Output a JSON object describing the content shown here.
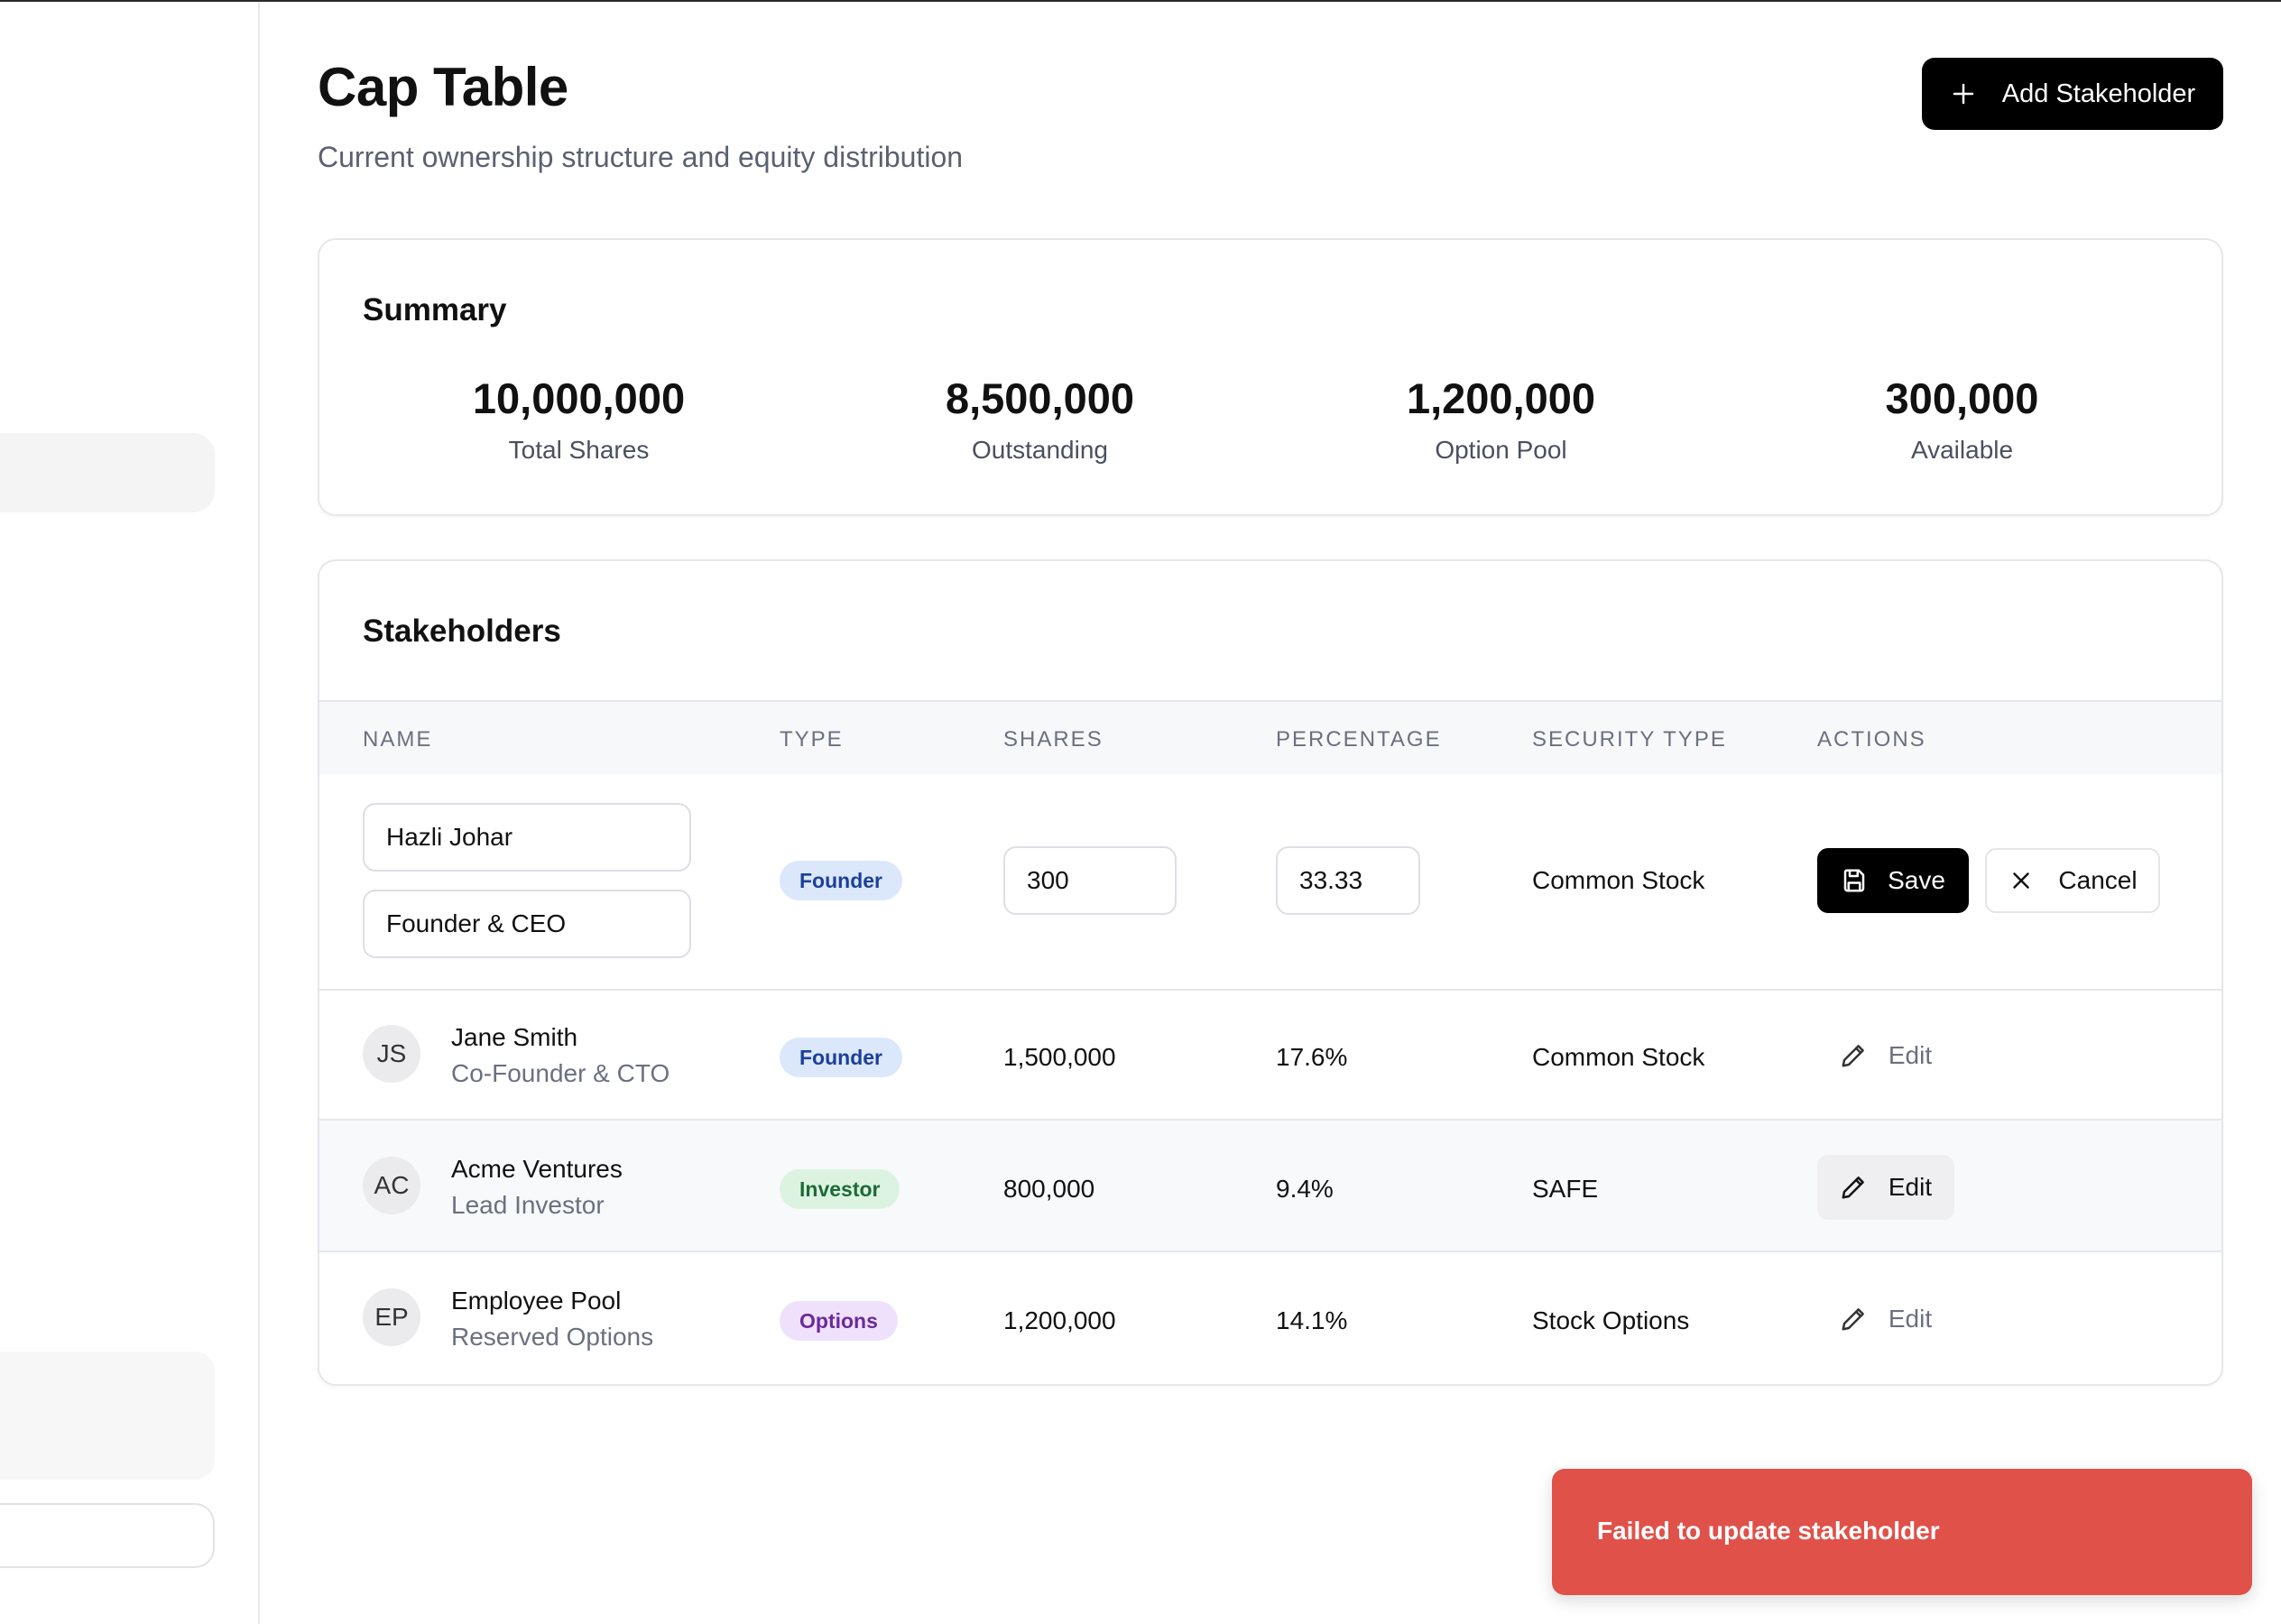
{
  "page": {
    "title": "Cap Table",
    "subtitle": "Current ownership structure and equity distribution",
    "add_button_label": "Add Stakeholder"
  },
  "summary": {
    "title": "Summary",
    "stats": [
      {
        "value": "10,000,000",
        "label": "Total Shares"
      },
      {
        "value": "8,500,000",
        "label": "Outstanding"
      },
      {
        "value": "1,200,000",
        "label": "Option Pool"
      },
      {
        "value": "300,000",
        "label": "Available"
      }
    ]
  },
  "stakeholders": {
    "title": "Stakeholders",
    "columns": [
      "Name",
      "Type",
      "Shares",
      "Percentage",
      "Security Type",
      "Actions"
    ],
    "editing_row": {
      "name_value": "Hazli Johar",
      "role_value": "Founder & CEO",
      "type": "Founder",
      "shares_value": "300",
      "percentage_value": "33.33",
      "security_type": "Common Stock",
      "save_label": "Save",
      "cancel_label": "Cancel"
    },
    "rows": [
      {
        "initials": "JS",
        "name": "Jane Smith",
        "role": "Co-Founder & CTO",
        "type": "Founder",
        "shares": "1,500,000",
        "percentage": "17.6%",
        "security_type": "Common Stock",
        "action_label": "Edit"
      },
      {
        "initials": "AC",
        "name": "Acme Ventures",
        "role": "Lead Investor",
        "type": "Investor",
        "shares": "800,000",
        "percentage": "9.4%",
        "security_type": "SAFE",
        "action_label": "Edit"
      },
      {
        "initials": "EP",
        "name": "Employee Pool",
        "role": "Reserved Options",
        "type": "Options",
        "shares": "1,200,000",
        "percentage": "14.1%",
        "security_type": "Stock Options",
        "action_label": "Edit"
      }
    ]
  },
  "toast": {
    "message": "Failed to update stakeholder",
    "color": "#e0514a"
  },
  "colors": {
    "primary_button": "#000000",
    "founder_badge_bg": "#dbe8fb",
    "investor_badge_bg": "#dcf3e2",
    "options_badge_bg": "#efe1fb"
  }
}
